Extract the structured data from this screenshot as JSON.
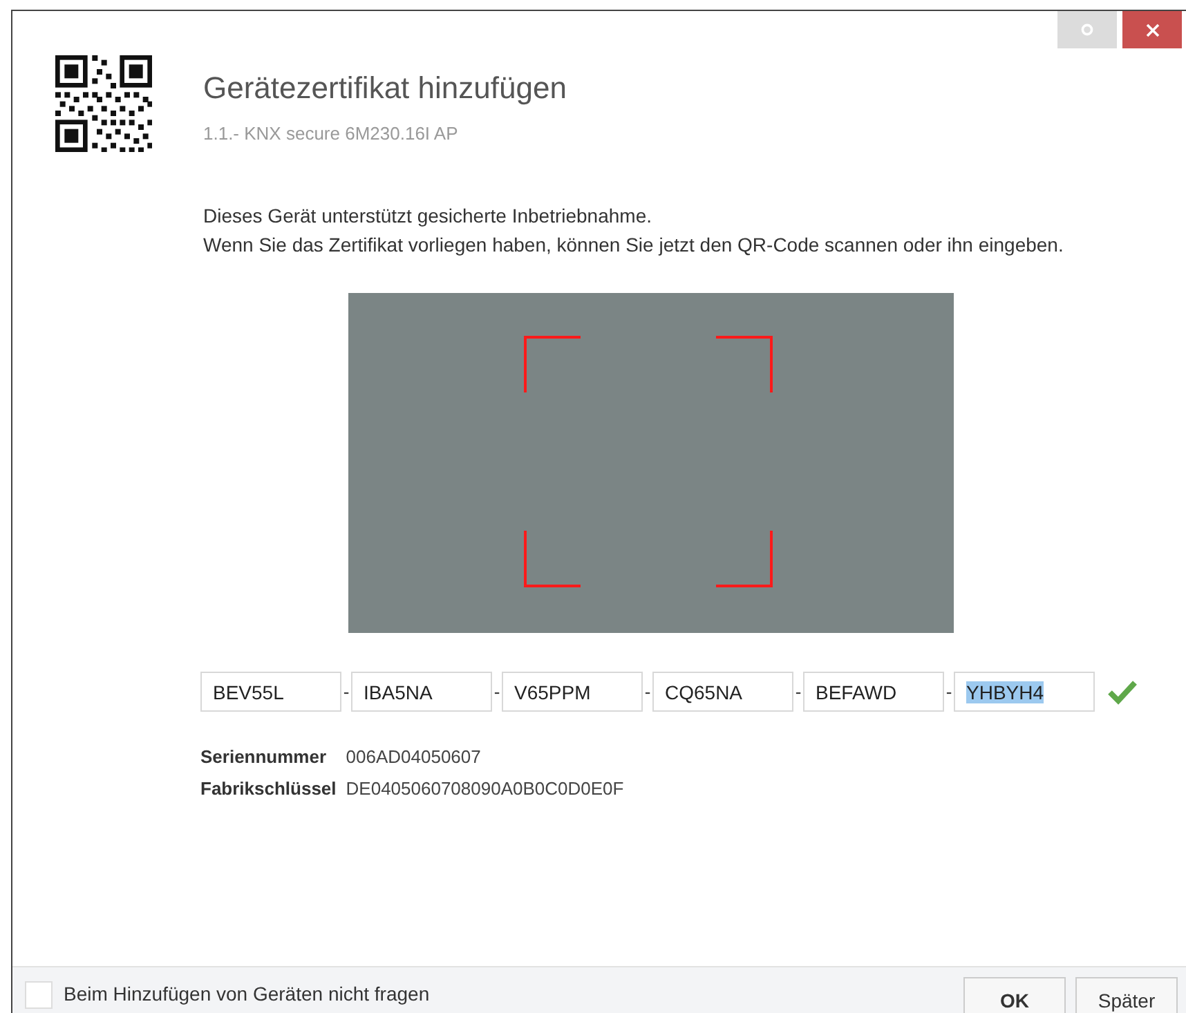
{
  "window": {
    "title_buttons": [
      {
        "kind": "settings"
      },
      {
        "kind": "close"
      }
    ]
  },
  "header": {
    "title": "Gerätezertifikat hinzufügen",
    "subtitle": "1.1.- KNX secure 6M230.16I AP"
  },
  "description": [
    "Dieses Gerät unterstützt gesicherte Inbetriebnahme.",
    "Wenn Sie das Zertifikat vorliegen haben, können Sie jetzt den QR-Code scannen oder ihn eingeben."
  ],
  "code_fields": [
    {
      "value": "BEV55L",
      "selected": false
    },
    {
      "value": "IBA5NA",
      "selected": false
    },
    {
      "value": "V65PPM",
      "selected": false
    },
    {
      "value": "CQ65NA",
      "selected": false
    },
    {
      "value": "BEFAWD",
      "selected": false
    },
    {
      "value": "YHBYH4",
      "selected": true
    }
  ],
  "separator": "-",
  "code_valid": true,
  "details": [
    {
      "label": "Seriennummer",
      "value": "006AD04050607"
    },
    {
      "label": "Fabrikschlüssel",
      "value": "DE0405060708090A0B0C0D0E0F"
    }
  ],
  "footer": {
    "checkbox": {
      "label": "Beim Hinzufügen von Geräten nicht fragen",
      "checked": false
    },
    "buttons": [
      "OK",
      "Später"
    ]
  }
}
